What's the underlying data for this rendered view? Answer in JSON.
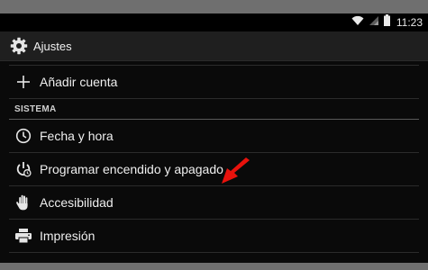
{
  "status_bar": {
    "time": "11:23"
  },
  "action_bar": {
    "title": "Ajustes",
    "app_icon": "gear-icon"
  },
  "list": {
    "add_account": {
      "label": "Añadir cuenta",
      "icon": "plus-icon"
    },
    "section_title": "SISTEMA",
    "items": [
      {
        "label": "Fecha y hora",
        "icon": "clock-icon"
      },
      {
        "label": "Programar encendido y apagado",
        "icon": "power-schedule-icon"
      },
      {
        "label": "Accesibilidad",
        "icon": "hand-icon"
      },
      {
        "label": "Impresión",
        "icon": "printer-icon"
      }
    ]
  },
  "colors": {
    "annotation_arrow": "#e8120c",
    "background": "#0a0a0a"
  }
}
